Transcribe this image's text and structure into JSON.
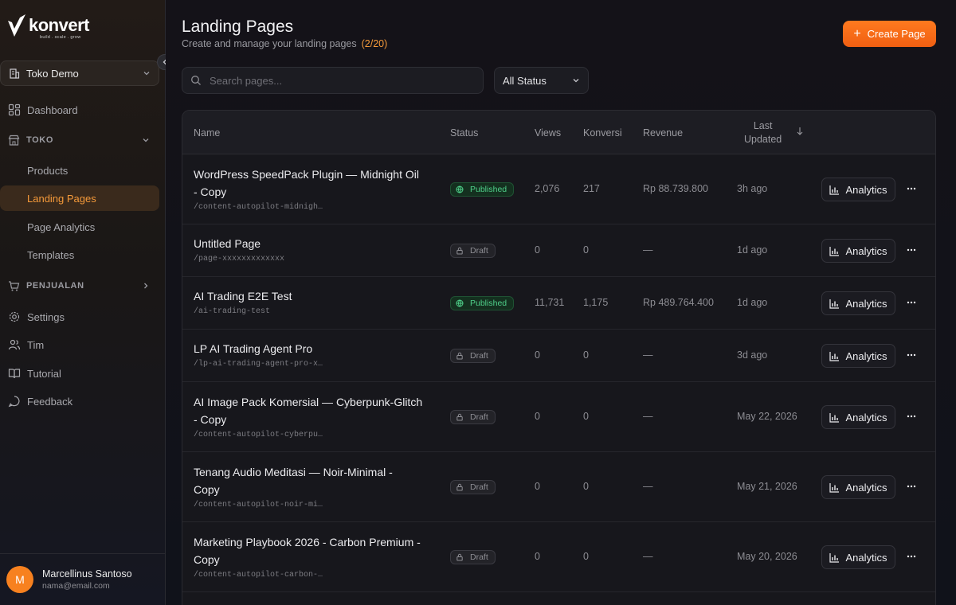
{
  "brand": {
    "name": "konvert",
    "tagline": "build . scale . grow"
  },
  "store": {
    "name": "Toko Demo"
  },
  "sidebar": {
    "dashboard": "Dashboard",
    "group_toko": "TOKO",
    "toko_items": [
      "Products",
      "Landing Pages",
      "Page Analytics",
      "Templates"
    ],
    "group_penjualan": "PENJUALAN",
    "settings": "Settings",
    "tim": "Tim",
    "tutorial": "Tutorial",
    "feedback": "Feedback"
  },
  "user": {
    "name": "Marcellinus Santoso",
    "email": "nama@email.com",
    "initial": "M"
  },
  "header": {
    "title": "Landing Pages",
    "subtitle": "Create and manage your landing pages",
    "count": "(2/20)",
    "create_label": "Create Page"
  },
  "search": {
    "placeholder": "Search pages..."
  },
  "filter": {
    "selected": "All Status"
  },
  "table": {
    "columns": {
      "name": "Name",
      "status": "Status",
      "views": "Views",
      "konversi": "Konversi",
      "revenue": "Revenue",
      "updated_1": "Last",
      "updated_2": "Updated"
    },
    "analytics_label": "Analytics",
    "rows": [
      {
        "title_1": "WordPress SpeedPack Plugin — Midnight Oil",
        "title_2": "- Copy",
        "slug": "/content-autopilot-midnigh…",
        "status": "Published",
        "views": "2,076",
        "konversi": "217",
        "revenue": "Rp 88.739.800",
        "updated": "3h ago"
      },
      {
        "title_1": "Untitled Page",
        "title_2": "",
        "slug": "/page-xxxxxxxxxxxxx",
        "status": "Draft",
        "views": "0",
        "konversi": "0",
        "revenue": "—",
        "updated": "1d ago"
      },
      {
        "title_1": "AI Trading E2E Test",
        "title_2": "",
        "slug": "/ai-trading-test",
        "status": "Published",
        "views": "11,731",
        "konversi": "1,175",
        "revenue": "Rp 489.764.400",
        "updated": "1d ago"
      },
      {
        "title_1": "LP AI Trading Agent Pro",
        "title_2": "",
        "slug": "/lp-ai-trading-agent-pro-x…",
        "status": "Draft",
        "views": "0",
        "konversi": "0",
        "revenue": "—",
        "updated": "3d ago"
      },
      {
        "title_1": "AI Image Pack Komersial — Cyberpunk-Glitch",
        "title_2": "- Copy",
        "slug": "/content-autopilot-cyberpu…",
        "status": "Draft",
        "views": "0",
        "konversi": "0",
        "revenue": "—",
        "updated": "May 22, 2026"
      },
      {
        "title_1": "Tenang Audio Meditasi — Noir-Minimal -",
        "title_2": "Copy",
        "slug": "/content-autopilot-noir-mi…",
        "status": "Draft",
        "views": "0",
        "konversi": "0",
        "revenue": "—",
        "updated": "May 21, 2026"
      },
      {
        "title_1": "Marketing Playbook 2026 - Carbon Premium -",
        "title_2": "Copy",
        "slug": "/content-autopilot-carbon-…",
        "status": "Draft",
        "views": "0",
        "konversi": "0",
        "revenue": "—",
        "updated": "May 20, 2026"
      }
    ]
  },
  "colors": {
    "accent": "#f7811f",
    "published": "#4fd08a",
    "active_nav_bg": "#3a2a1c"
  }
}
